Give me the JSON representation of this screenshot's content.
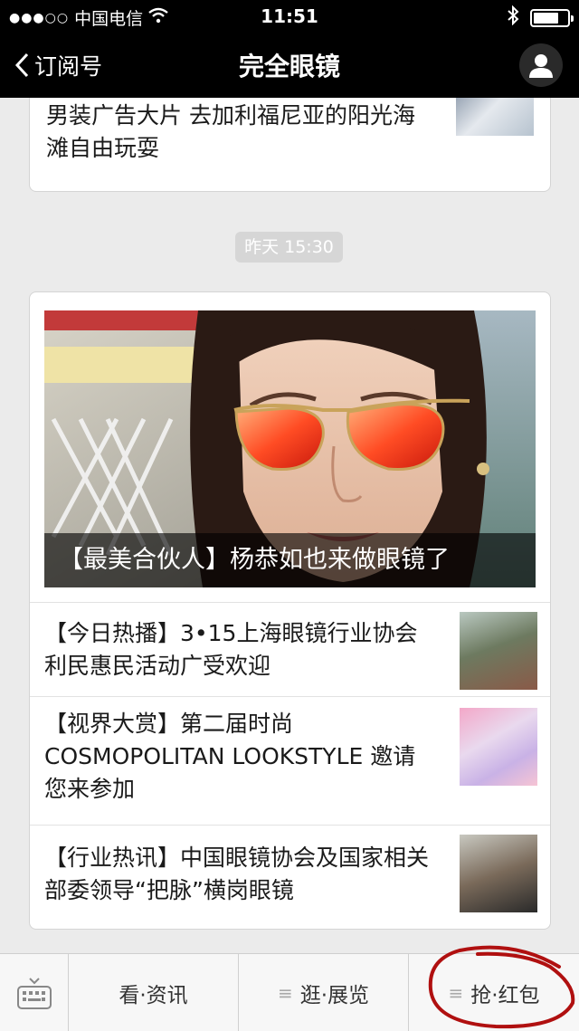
{
  "status_bar": {
    "signal": "●●●○○",
    "carrier": "中国电信",
    "time": "11:51",
    "battery_level": 0.75
  },
  "nav": {
    "back_label": "订阅号",
    "title": "完全眼镜"
  },
  "top_card": {
    "text": "男装广告大片 去加利福尼亚的阳光海滩自由玩耍"
  },
  "timestamp": "昨天 15:30",
  "feature_card": {
    "hero_caption": "【最美合伙人】杨恭如也来做眼镜了",
    "articles": [
      {
        "title": "【今日热播】3•15上海眼镜行业协会 利民惠民活动广受欢迎"
      },
      {
        "title": "【视界大赏】第二届时尚COSMOPOLITAN LOOKSTYLE 邀请您来参加"
      },
      {
        "title": "【行业热讯】中国眼镜协会及国家相关部委领导“把脉”横岗眼镜"
      }
    ]
  },
  "menu": {
    "items": [
      {
        "label": "看·资讯",
        "has_submenu": false
      },
      {
        "label": "逛·展览",
        "has_submenu": true
      },
      {
        "label": "抢·红包",
        "has_submenu": true
      }
    ]
  },
  "colors": {
    "bar_bg": "#000000",
    "page_bg": "#ebebeb",
    "annotation_red": "#b01010"
  }
}
